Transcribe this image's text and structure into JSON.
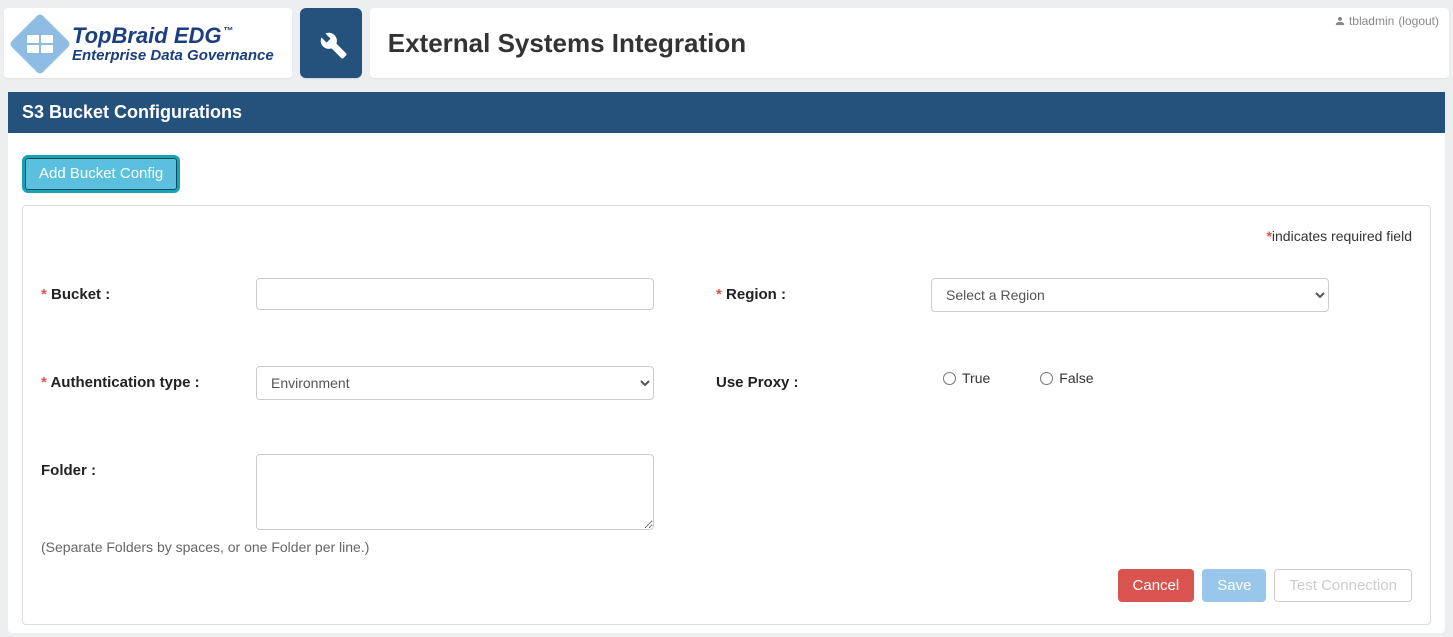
{
  "brand": {
    "main": "TopBraid EDG",
    "tm": "™",
    "sub": "Enterprise Data Governance"
  },
  "page_title": "External Systems Integration",
  "user": {
    "name": "tbladmin",
    "logout_label": "(logout)"
  },
  "section_title": "S3 Bucket Configurations",
  "add_button": "Add Bucket Config",
  "required_note": "indicates required field",
  "form": {
    "bucket": {
      "label": "Bucket :",
      "value": ""
    },
    "region": {
      "label": "Region :",
      "placeholder": "Select a Region"
    },
    "auth": {
      "label": "Authentication type :",
      "value": "Environment"
    },
    "proxy": {
      "label": "Use Proxy :",
      "true": "True",
      "false": "False"
    },
    "folder": {
      "label": "Folder :",
      "value": "",
      "hint": "(Separate Folders by spaces, or one Folder per line.)"
    }
  },
  "buttons": {
    "cancel": "Cancel",
    "save": "Save",
    "test": "Test Connection"
  }
}
